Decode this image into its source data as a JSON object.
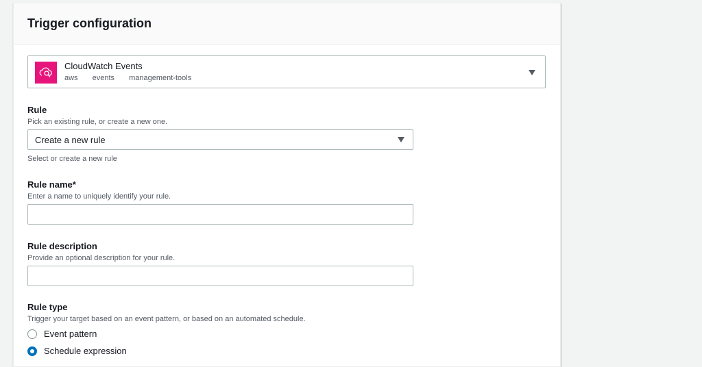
{
  "panel": {
    "title": "Trigger configuration"
  },
  "trigger": {
    "name": "CloudWatch Events",
    "tags": [
      "aws",
      "events",
      "management-tools"
    ],
    "logo_color": "#e7157b"
  },
  "rule": {
    "label": "Rule",
    "description": "Pick an existing rule, or create a new one.",
    "selected": "Create a new rule",
    "hint": "Select or create a new rule"
  },
  "rule_name": {
    "label": "Rule name*",
    "description": "Enter a name to uniquely identify your rule.",
    "value": ""
  },
  "rule_description": {
    "label": "Rule description",
    "description": "Provide an optional description for your rule.",
    "value": ""
  },
  "rule_type": {
    "label": "Rule type",
    "description": "Trigger your target based on an event pattern, or based on an automated schedule.",
    "options": [
      {
        "label": "Event pattern",
        "checked": false
      },
      {
        "label": "Schedule expression",
        "checked": true
      }
    ]
  },
  "colors": {
    "accent": "#0073bb",
    "border": "#aab7b8",
    "muted_text": "#545b64"
  }
}
